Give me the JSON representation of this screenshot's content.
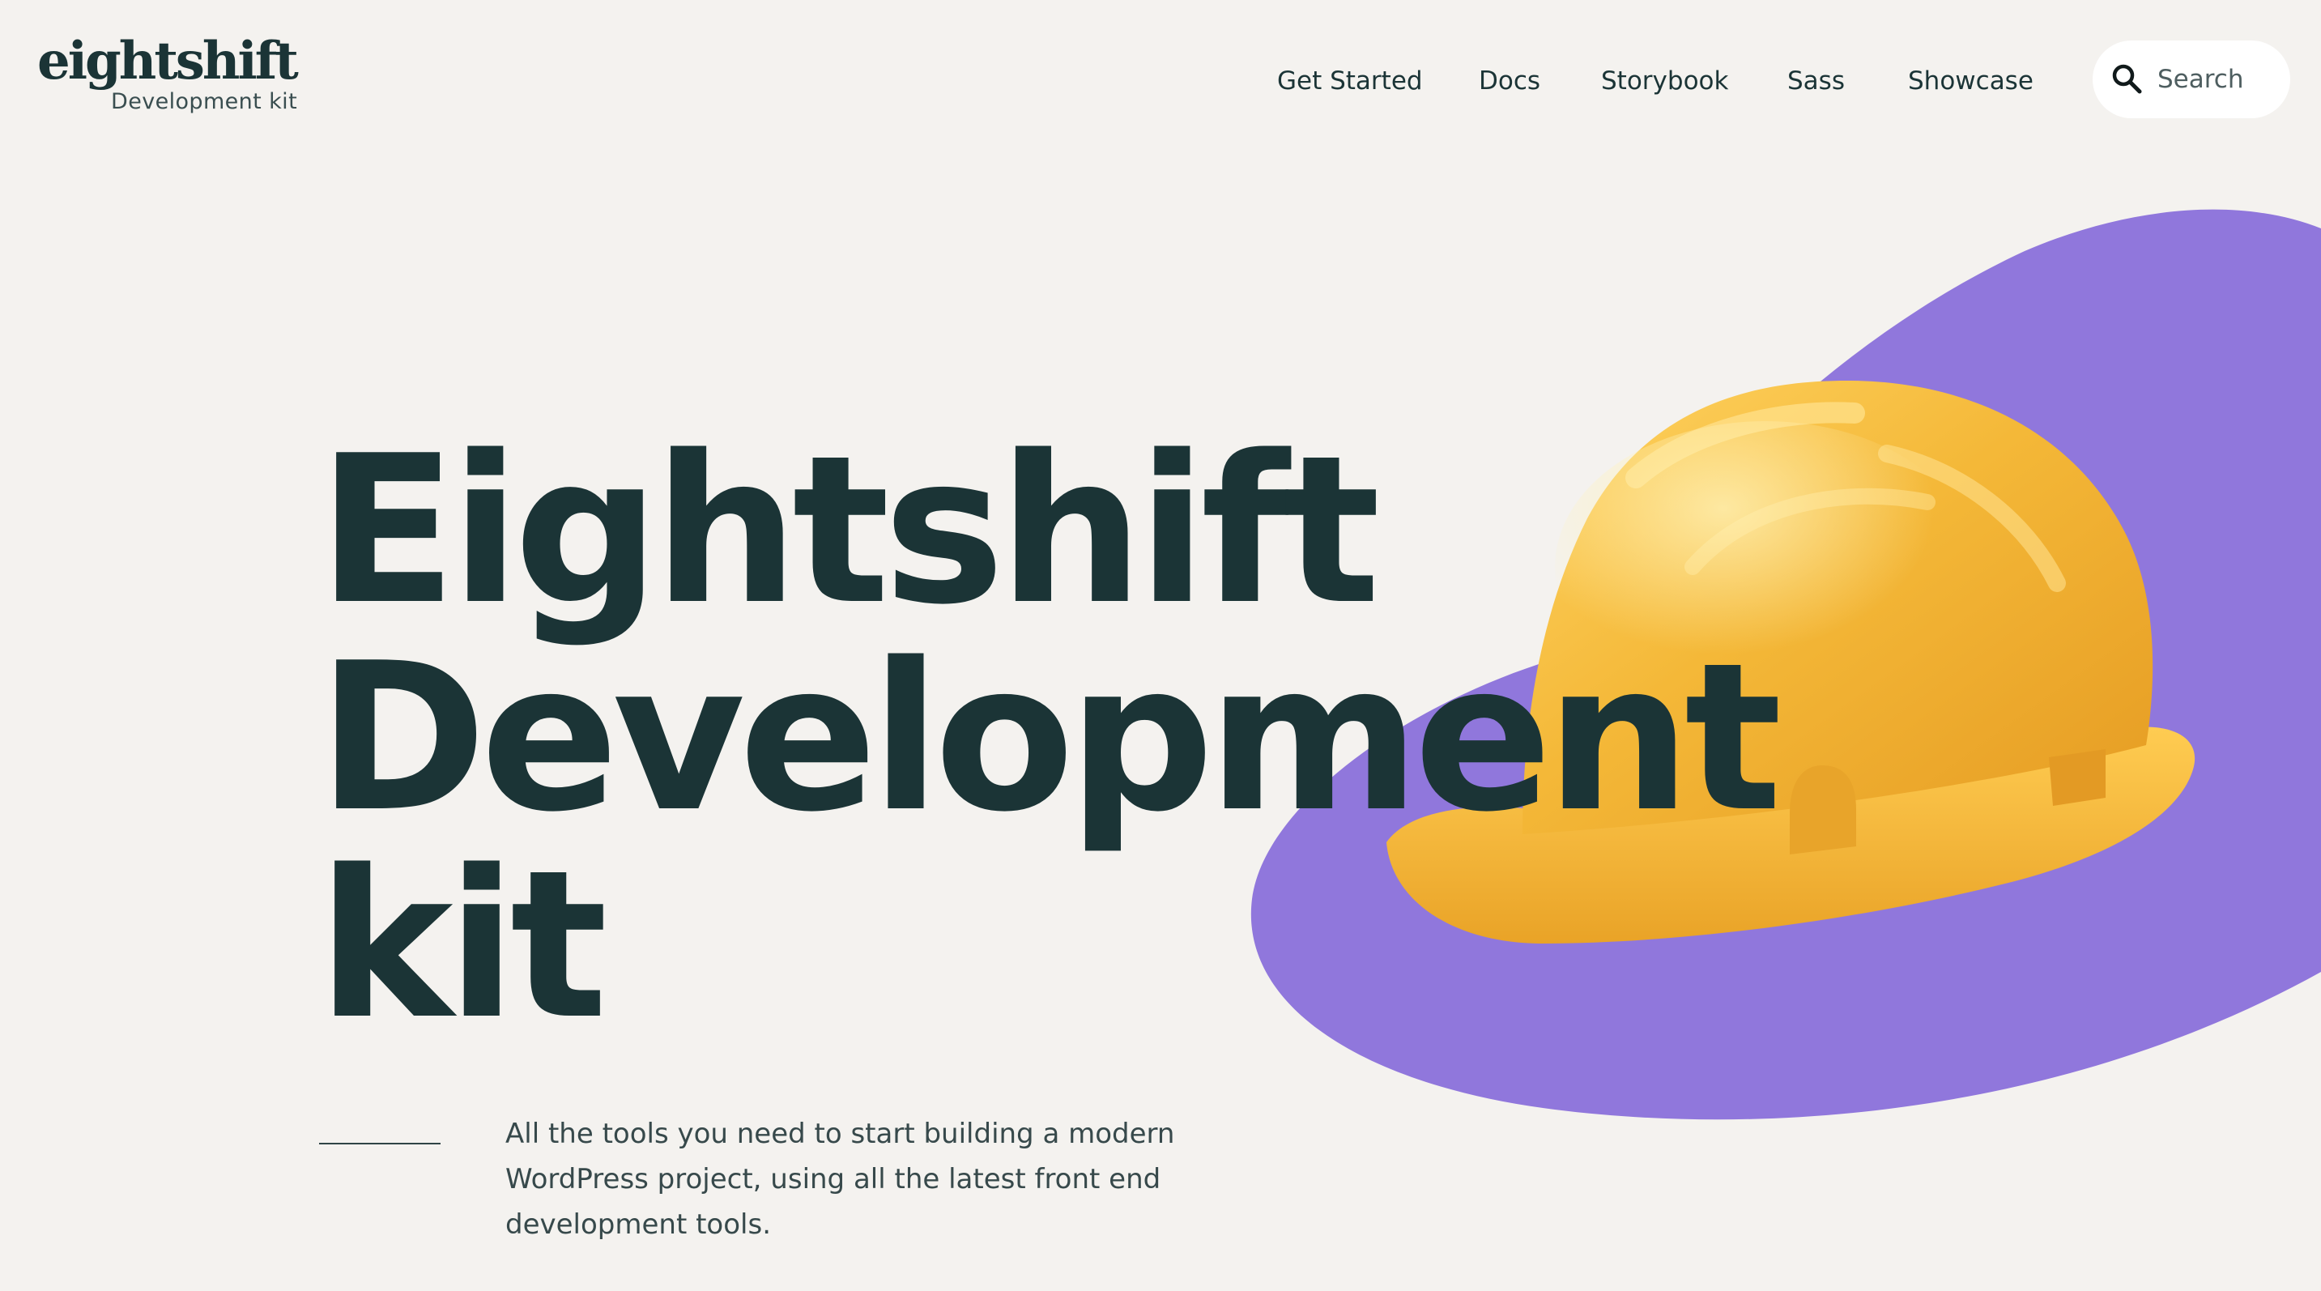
{
  "logo": {
    "wordmark": "eightshift",
    "subtitle": "Development kit"
  },
  "nav": {
    "items": [
      {
        "label": "Get Started"
      },
      {
        "label": "Docs"
      },
      {
        "label": "Storybook"
      },
      {
        "label": "Sass"
      },
      {
        "label": "Showcase"
      }
    ]
  },
  "search": {
    "label": "Search",
    "icon": "search-icon"
  },
  "hero": {
    "title_lines": [
      "Eightshift",
      "Development",
      "kit"
    ],
    "description": "All the tools you need to start building a modern WordPress project, using all the latest front end development tools.",
    "image": "hard-hat-illustration"
  },
  "colors": {
    "background": "#f4f2ef",
    "text": "#1b3436",
    "blob": "#9077dc",
    "helmet": "#f2b33a"
  }
}
